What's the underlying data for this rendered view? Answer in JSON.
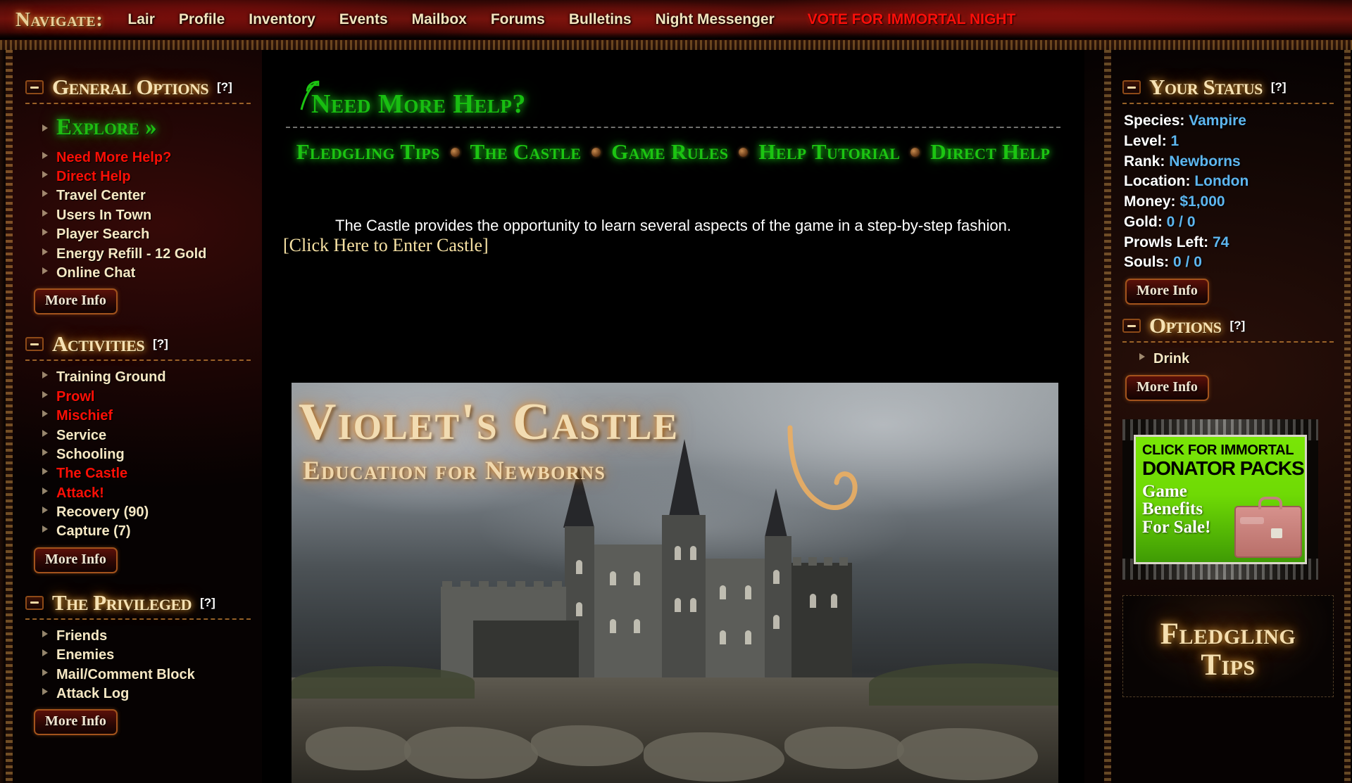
{
  "topnav": {
    "brand": "Navigate:",
    "links": [
      {
        "label": "Lair"
      },
      {
        "label": "Profile"
      },
      {
        "label": "Inventory"
      },
      {
        "label": "Events"
      },
      {
        "label": "Mailbox"
      },
      {
        "label": "Forums"
      },
      {
        "label": "Bulletins"
      },
      {
        "label": "Night Messenger"
      }
    ],
    "vote_label": "VOTE FOR IMMORTAL NIGHT",
    "vote_color": "#fb0f06"
  },
  "sidebar_left": {
    "general": {
      "title": "General Options",
      "help": "[?]",
      "explore_label": "Explore »",
      "items": [
        {
          "label": "Need More Help?",
          "style": "red"
        },
        {
          "label": "Direct Help",
          "style": "red"
        },
        {
          "label": "Travel Center",
          "style": "normal"
        },
        {
          "label": "Users In Town",
          "style": "normal"
        },
        {
          "label": "Player Search",
          "style": "normal"
        },
        {
          "label": "Energy Refill - 12 Gold",
          "style": "normal"
        },
        {
          "label": "Online Chat",
          "style": "normal"
        }
      ],
      "more_info": "More Info"
    },
    "activities": {
      "title": "Activities",
      "help": "[?]",
      "items": [
        {
          "label": "Training Ground",
          "style": "normal"
        },
        {
          "label": "Prowl",
          "style": "red"
        },
        {
          "label": "Mischief",
          "style": "red"
        },
        {
          "label": "Service",
          "style": "normal"
        },
        {
          "label": "Schooling",
          "style": "normal"
        },
        {
          "label": "The Castle",
          "style": "red"
        },
        {
          "label": "Attack!",
          "style": "red"
        },
        {
          "label": "Recovery (90)",
          "style": "normal"
        },
        {
          "label": "Capture (7)",
          "style": "normal"
        }
      ],
      "more_info": "More Info"
    },
    "privileged": {
      "title": "The Privileged",
      "help": "[?]",
      "items": [
        {
          "label": "Friends",
          "style": "normal"
        },
        {
          "label": "Enemies",
          "style": "normal"
        },
        {
          "label": "Mail/Comment Block",
          "style": "normal"
        },
        {
          "label": "Attack Log",
          "style": "normal"
        }
      ],
      "more_info": "More Info"
    }
  },
  "main": {
    "page_title": "Need More Help?",
    "subnav": [
      {
        "label": "Fledgling Tips"
      },
      {
        "label": "The Castle"
      },
      {
        "label": "Game Rules"
      },
      {
        "label": "Help Tutorial"
      },
      {
        "label": "Direct Help"
      }
    ],
    "intro": "The Castle provides the opportunity to learn several aspects of the game in a step-by-step fashion.",
    "enter_link": "[Click Here to Enter Castle]",
    "banner": {
      "title": "Violet's Castle",
      "subtitle": "Education for Newborns"
    }
  },
  "sidebar_right": {
    "status": {
      "title": "Your Status",
      "help": "[?]",
      "rows": [
        {
          "label": "Species:",
          "value": "Vampire"
        },
        {
          "label": "Level:",
          "value": "1"
        },
        {
          "label": "Rank:",
          "value": "Newborns"
        },
        {
          "label": "Location:",
          "value": "London"
        },
        {
          "label": "Money:",
          "value": "$1,000"
        },
        {
          "label": "Gold:",
          "value": "0 / 0"
        },
        {
          "label": "Prowls Left:",
          "value": "74"
        },
        {
          "label": "Souls:",
          "value": "0 / 0"
        }
      ],
      "more_info": "More Info"
    },
    "options": {
      "title": "Options",
      "help": "[?]",
      "items": [
        {
          "label": "Drink",
          "style": "normal"
        }
      ],
      "more_info": "More Info"
    },
    "ad": {
      "line1": "CLICK FOR IMMORTAL",
      "line2": "DONATOR PACKS",
      "line3a": "Game",
      "line3b": "Benefits",
      "line3c": "For Sale!"
    },
    "tips": {
      "line1": "Fledgling",
      "line2": "Tips"
    }
  }
}
